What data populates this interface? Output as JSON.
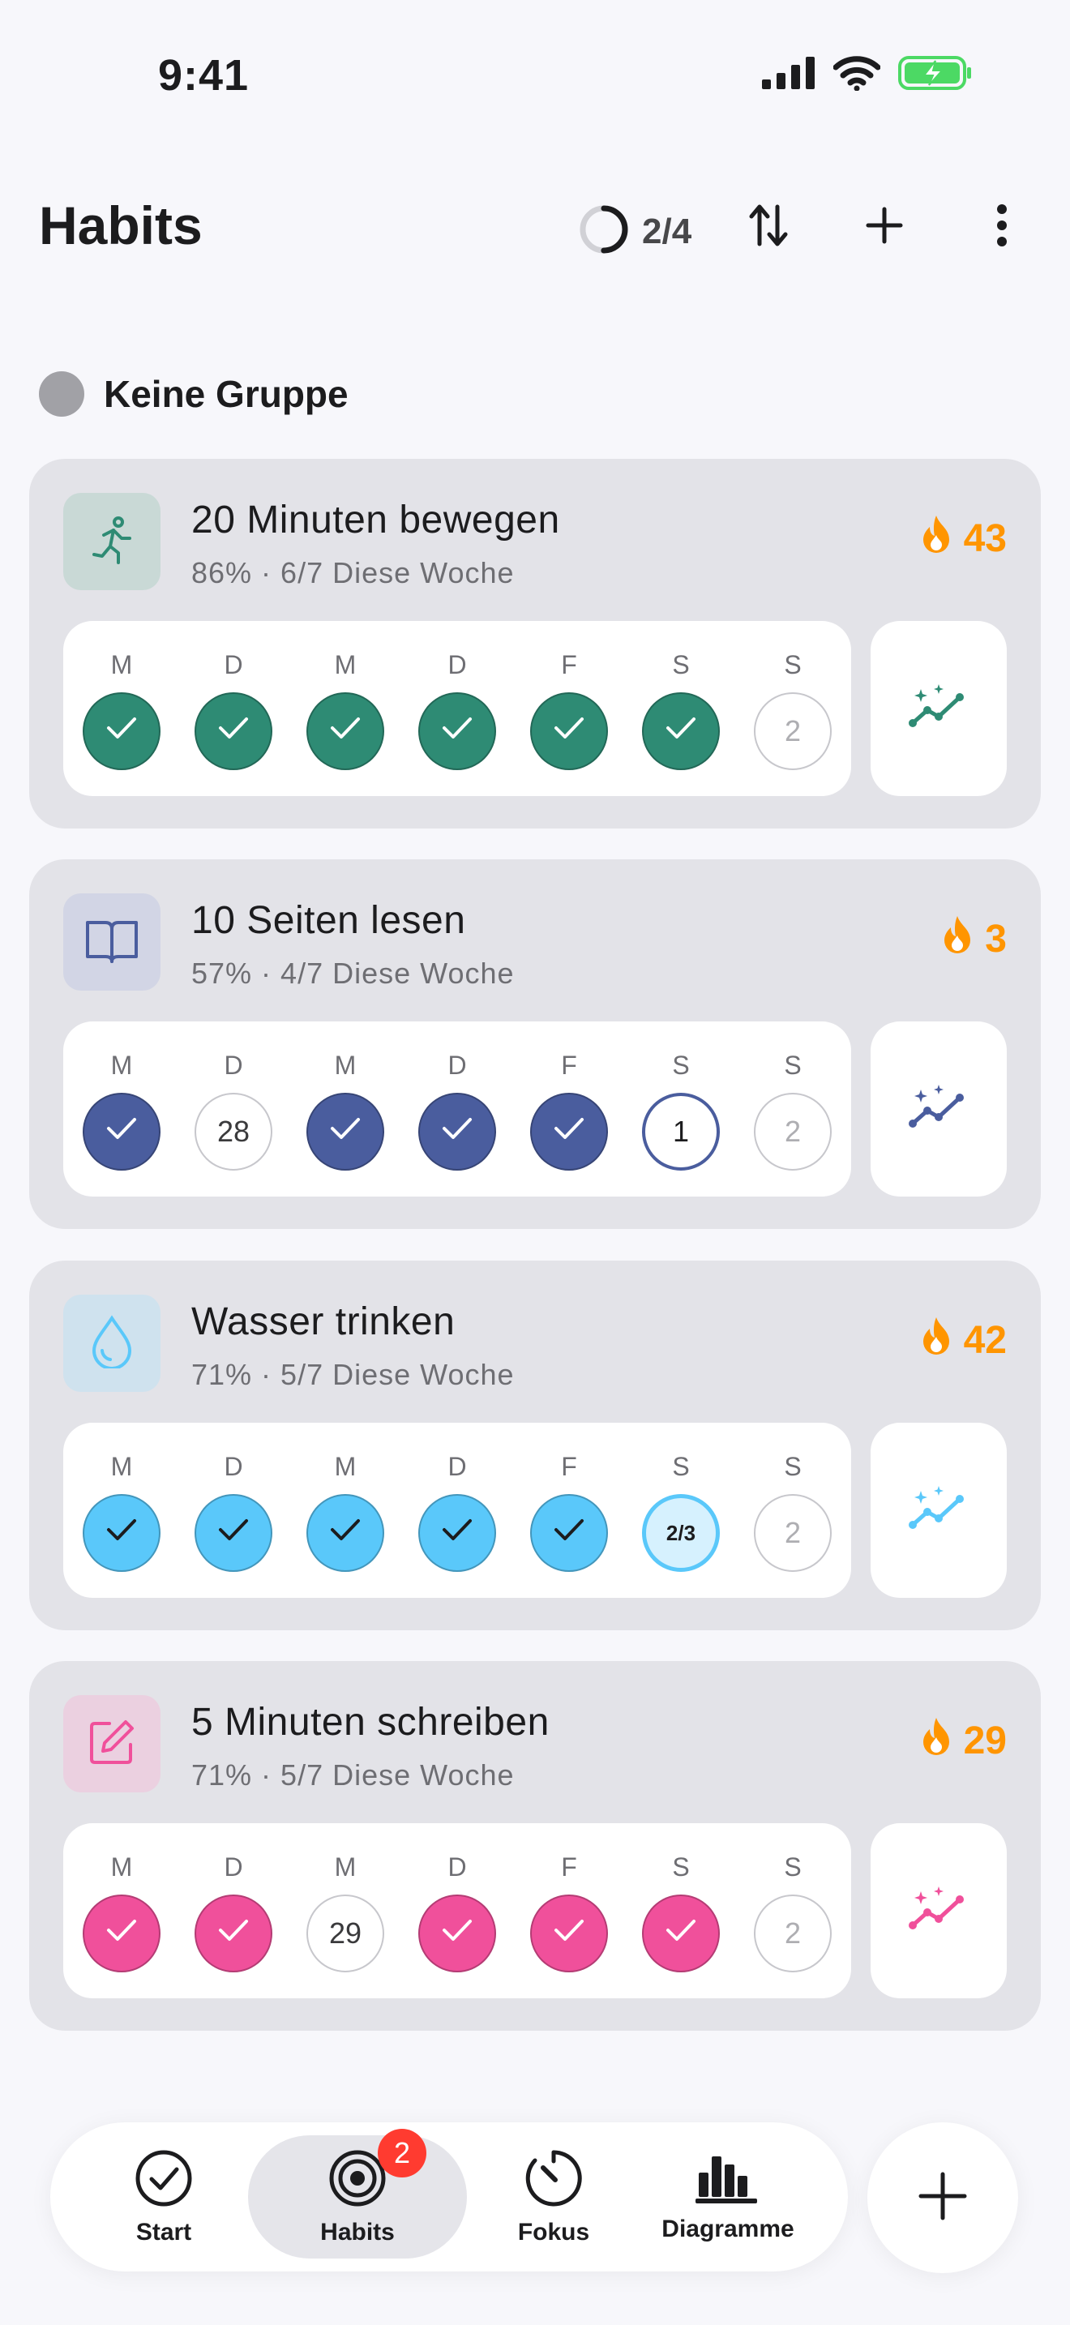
{
  "status_bar": {
    "time": "9:41"
  },
  "header": {
    "title": "Habits",
    "progress": "2/4",
    "progress_fraction": 0.5
  },
  "group": {
    "label": "Keine Gruppe"
  },
  "habits": [
    {
      "name": "20 Minuten bewegen",
      "subtitle": "86% · 6/7 Diese Woche",
      "streak": "43",
      "icon": "running-figure-icon",
      "color": "#2e8b74",
      "bg": "#c9d9d6",
      "days": [
        {
          "label": "M",
          "state": "done",
          "text": ""
        },
        {
          "label": "D",
          "state": "done",
          "text": ""
        },
        {
          "label": "M",
          "state": "done",
          "text": ""
        },
        {
          "label": "D",
          "state": "done",
          "text": ""
        },
        {
          "label": "F",
          "state": "done",
          "text": ""
        },
        {
          "label": "S",
          "state": "done",
          "text": ""
        },
        {
          "label": "S",
          "state": "future",
          "text": "2"
        }
      ]
    },
    {
      "name": "10 Seiten lesen",
      "subtitle": "57% · 4/7 Diese Woche",
      "streak": "3",
      "icon": "open-book-icon",
      "color": "#4a5d9e",
      "bg": "#d2d5e5",
      "days": [
        {
          "label": "M",
          "state": "done",
          "text": ""
        },
        {
          "label": "D",
          "state": "missed",
          "text": "28"
        },
        {
          "label": "M",
          "state": "done",
          "text": ""
        },
        {
          "label": "D",
          "state": "done",
          "text": ""
        },
        {
          "label": "F",
          "state": "done",
          "text": ""
        },
        {
          "label": "S",
          "state": "today",
          "text": "1"
        },
        {
          "label": "S",
          "state": "future",
          "text": "2"
        }
      ]
    },
    {
      "name": "Wasser trinken",
      "subtitle": "71% · 5/7 Diese Woche",
      "streak": "42",
      "icon": "water-drop-icon",
      "color": "#5ac8fa",
      "bg": "#cfe2ee",
      "days": [
        {
          "label": "M",
          "state": "done",
          "text": ""
        },
        {
          "label": "D",
          "state": "done",
          "text": ""
        },
        {
          "label": "M",
          "state": "done",
          "text": ""
        },
        {
          "label": "D",
          "state": "done",
          "text": ""
        },
        {
          "label": "F",
          "state": "done",
          "text": ""
        },
        {
          "label": "S",
          "state": "partial",
          "text": "2/3"
        },
        {
          "label": "S",
          "state": "future",
          "text": "2"
        }
      ]
    },
    {
      "name": "5 Minuten schreiben",
      "subtitle": "71% · 5/7 Diese Woche",
      "streak": "29",
      "icon": "edit-note-icon",
      "color": "#f0509b",
      "bg": "#ebd0e0",
      "days": [
        {
          "label": "M",
          "state": "done",
          "text": ""
        },
        {
          "label": "D",
          "state": "done",
          "text": ""
        },
        {
          "label": "M",
          "state": "missed",
          "text": "29"
        },
        {
          "label": "D",
          "state": "done",
          "text": ""
        },
        {
          "label": "F",
          "state": "done",
          "text": ""
        },
        {
          "label": "S",
          "state": "done",
          "text": ""
        },
        {
          "label": "S",
          "state": "future",
          "text": "2"
        }
      ]
    }
  ],
  "tabbar": {
    "tabs": [
      {
        "label": "Start",
        "icon": "check-circle-icon"
      },
      {
        "label": "Habits",
        "icon": "target-icon",
        "badge": "2",
        "active": true
      },
      {
        "label": "Fokus",
        "icon": "timer-icon"
      },
      {
        "label": "Diagramme",
        "icon": "bar-chart-icon"
      }
    ]
  },
  "colors": {
    "streak": "#ff9500",
    "badge": "#ff3b30"
  }
}
